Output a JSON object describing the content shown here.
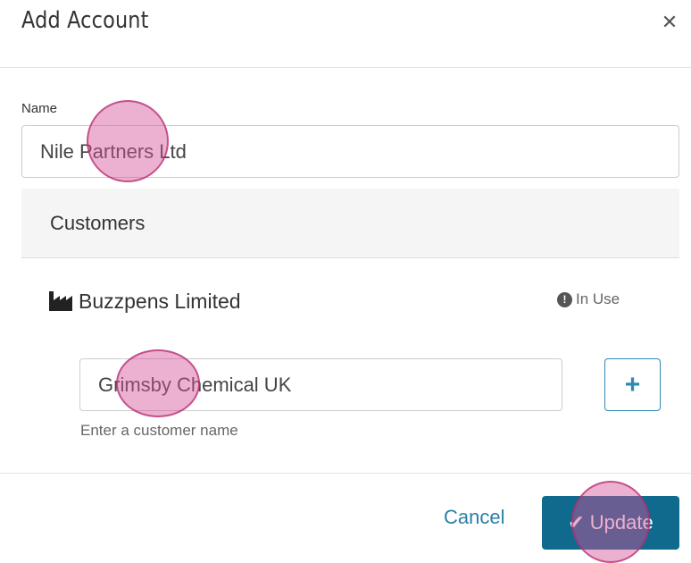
{
  "dialog": {
    "title": "Add Account",
    "close_icon": "close-icon"
  },
  "name_field": {
    "label": "Name",
    "value": "Nile Partners Ltd"
  },
  "customers": {
    "section_title": "Customers",
    "items": [
      {
        "icon": "factory-icon",
        "name": "Buzzpens Limited",
        "status_icon": "info-icon",
        "status": "In Use"
      }
    ],
    "new_customer": {
      "value": "Grimsby Chemical UK",
      "helper": "Enter a customer name",
      "add_icon": "plus-icon"
    }
  },
  "footer": {
    "cancel_label": "Cancel",
    "update_label": "Update",
    "update_icon": "check-icon"
  },
  "colors": {
    "primary": "#0f6a8e",
    "link": "#2a7fa8",
    "accent_outline": "#2d8bb0",
    "panel_bg": "#f5f5f5"
  }
}
